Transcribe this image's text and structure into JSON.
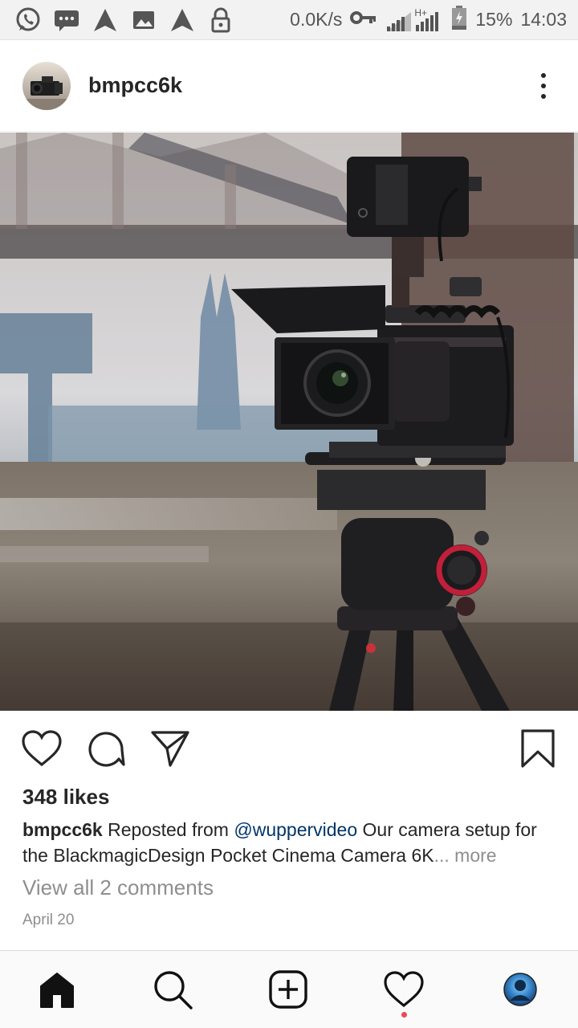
{
  "status_bar": {
    "icons": [
      "whatsapp-icon",
      "message-icon",
      "navigation-icon",
      "image-icon",
      "navigation-icon",
      "lock-icon"
    ],
    "network_speed": "0.0K/s",
    "network_type": "H+",
    "battery": "15%",
    "time": "14:03"
  },
  "post": {
    "username": "bmpcc6k",
    "likes": "348 likes",
    "caption": {
      "user": "bmpcc6k",
      "text_before": " Reposted from ",
      "mention": "@wuppervideo",
      "text_after": " Our camera setup for the BlackmagicDesign Pocket Cinema Camera 6K",
      "ellipsis": "...",
      "more": " more"
    },
    "view_comments": "View all 2 comments",
    "date": "April 20"
  },
  "nav": {
    "items": [
      "home-icon",
      "search-icon",
      "add-post-icon",
      "activity-icon",
      "profile-avatar"
    ],
    "has_activity_notification": true
  },
  "colors": {
    "text": "#262626",
    "secondary": "#8e8e8e",
    "mention": "#003569",
    "notification": "#ed4956"
  }
}
